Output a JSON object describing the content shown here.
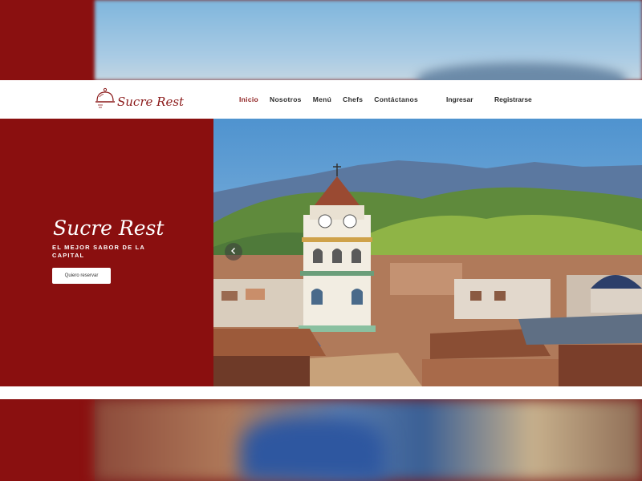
{
  "brand": {
    "name": "Sucre Rest",
    "accent": "#8b1a1a",
    "hero_bg": "#8a0f0f"
  },
  "nav": {
    "items": [
      {
        "label": "Inicio",
        "active": true
      },
      {
        "label": "Nosotros"
      },
      {
        "label": "Menú"
      },
      {
        "label": "Chefs"
      },
      {
        "label": "Contáctanos"
      }
    ],
    "login_label": "Ingresar",
    "register_label": "Registrarse"
  },
  "hero": {
    "title": "Sucre Rest",
    "subtitle": "EL MEJOR SABOR DE LA CAPITAL",
    "cta_label": "Quiero reservar",
    "prev_icon": "chevron-left-icon"
  },
  "icons": {
    "logo": "cloche-icon"
  }
}
